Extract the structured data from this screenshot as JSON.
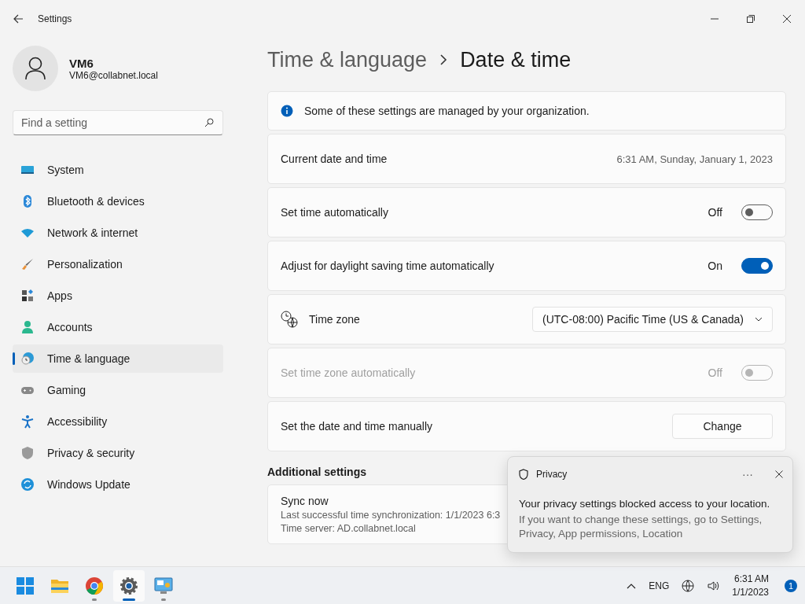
{
  "window": {
    "title": "Settings"
  },
  "account": {
    "name": "VM6",
    "email": "VM6@collabnet.local"
  },
  "search": {
    "placeholder": "Find a setting"
  },
  "nav": [
    {
      "label": "System",
      "selected": false
    },
    {
      "label": "Bluetooth & devices",
      "selected": false
    },
    {
      "label": "Network & internet",
      "selected": false
    },
    {
      "label": "Personalization",
      "selected": false
    },
    {
      "label": "Apps",
      "selected": false
    },
    {
      "label": "Accounts",
      "selected": false
    },
    {
      "label": "Time & language",
      "selected": true
    },
    {
      "label": "Gaming",
      "selected": false
    },
    {
      "label": "Accessibility",
      "selected": false
    },
    {
      "label": "Privacy & security",
      "selected": false
    },
    {
      "label": "Windows Update",
      "selected": false
    }
  ],
  "breadcrumb": [
    "Time & language",
    "Date & time"
  ],
  "banner": {
    "text": "Some of these settings are managed by your organization."
  },
  "settings": [
    {
      "kind": "info",
      "label": "Current date and time",
      "value": "6:31 AM, Sunday, January 1, 2023"
    },
    {
      "kind": "toggle",
      "label": "Set time automatically",
      "state_text": "Off",
      "on": false,
      "disabled": false
    },
    {
      "kind": "toggle",
      "label": "Adjust for daylight saving time automatically",
      "state_text": "On",
      "on": true,
      "disabled": false
    },
    {
      "kind": "dropdown",
      "label": "Time zone",
      "value": "(UTC-08:00) Pacific Time (US & Canada)"
    },
    {
      "kind": "toggle",
      "label": "Set time zone automatically",
      "state_text": "Off",
      "on": false,
      "disabled": true
    },
    {
      "kind": "button",
      "label": "Set the date and time manually",
      "button": "Change"
    }
  ],
  "additional": {
    "heading": "Additional settings",
    "sync": {
      "title": "Sync now",
      "lines": [
        "Last successful time synchronization: 1/1/2023 6:3",
        "Time server: AD.collabnet.local"
      ]
    }
  },
  "toast": {
    "app": "Privacy",
    "more": "···",
    "title": "Your privacy settings blocked access to your location.",
    "body": "If you want to change these settings, go to Settings, Privacy, App permissions, Location"
  },
  "taskbar": {
    "apps": [
      {
        "running": false,
        "selected": false
      },
      {
        "running": false,
        "selected": false
      },
      {
        "running": true,
        "selected": false
      },
      {
        "running": true,
        "selected": true
      },
      {
        "running": true,
        "selected": false
      }
    ],
    "language": "ENG",
    "time": "6:31 AM",
    "date": "1/1/2023",
    "badge": "1"
  }
}
